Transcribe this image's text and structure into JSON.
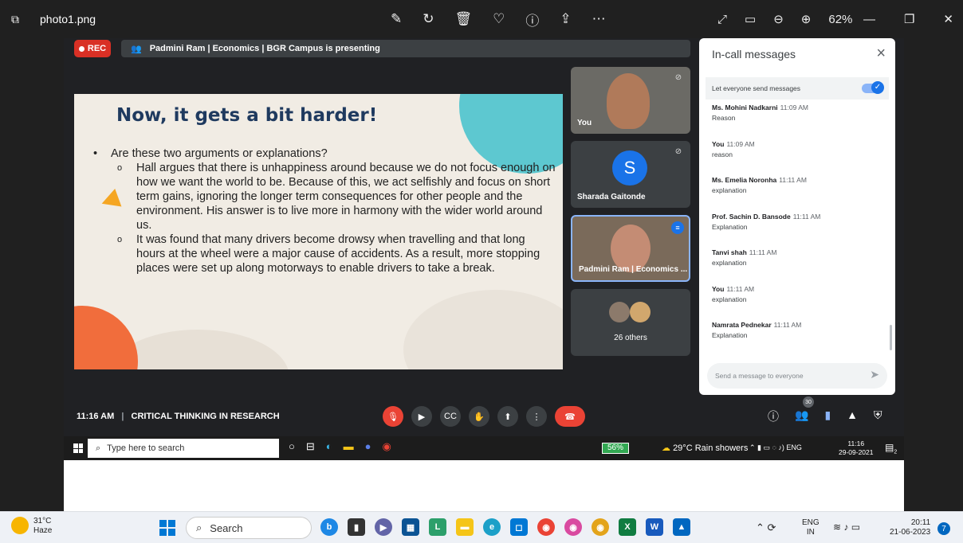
{
  "viewer": {
    "filename": "photo1.png",
    "zoom": "62%"
  },
  "meet": {
    "rec_label": "REC",
    "presenting_text": "Padmini Ram | Economics | BGR Campus is presenting",
    "slide": {
      "title": "Now, it gets a bit harder!",
      "bullet": "Are these two arguments or explanations?",
      "sub1": "Hall argues that there is unhappiness around because we do not focus enough on how we want the world to be. Because of this, we act selfishly and focus on short term gains, ignoring the longer term consequences for other people and the environment. His answer is to live more in harmony with the wider world around us.",
      "sub2": "It was found that many drivers become drowsy when travelling and that long hours at the wheel were a major cause of accidents. As a result, more stopping places were set up along motorways to enable drivers to take a break."
    },
    "tiles": {
      "you": "You",
      "sharada_initial": "S",
      "sharada": "Sharada Gaitonde",
      "padmini": "Padmini Ram | Economics ...",
      "others": "26 others"
    },
    "chat": {
      "title": "In-call messages",
      "toggle_label": "Let everyone send messages",
      "messages": [
        {
          "who": "Ms. Mohini Nadkarni",
          "time": "11:09 AM",
          "text": "Reason"
        },
        {
          "who": "You",
          "time": "11:09 AM",
          "text": "reason"
        },
        {
          "who": "Ms. Emelia Noronha",
          "time": "11:11 AM",
          "text": "explanation"
        },
        {
          "who": "Prof. Sachin D. Bansode",
          "time": "11:11 AM",
          "text": "Explanation"
        },
        {
          "who": "Tanvi shah",
          "time": "11:11 AM",
          "text": "explanation"
        },
        {
          "who": "You",
          "time": "11:11 AM",
          "text": "explanation"
        },
        {
          "who": "Namrata Pednekar",
          "time": "11:11 AM",
          "text": "Explanation"
        }
      ],
      "input_placeholder": "Send a message to everyone"
    },
    "meeting_time": "11:16 AM",
    "meeting_name": "CRITICAL THINKING IN RESEARCH",
    "participant_count": "30"
  },
  "inner_taskbar": {
    "search_placeholder": "Type here to search",
    "battery": "56%",
    "weather": "29°C Rain showers",
    "lang": "ENG",
    "time": "11:16",
    "date": "29-09-2021",
    "notif_count": "2"
  },
  "taskbar": {
    "temp": "31°C",
    "condition": "Haze",
    "search_label": "Search",
    "lang_line1": "ENG",
    "lang_line2": "IN",
    "time": "20:11",
    "date": "21-06-2023",
    "badge": "7"
  },
  "colors": {
    "accent": "#1a73e8",
    "rec_red": "#d93025",
    "slide_title": "#1f3a5f",
    "slide_orange": "#f16d3c",
    "slide_teal": "#5dc8d0"
  }
}
